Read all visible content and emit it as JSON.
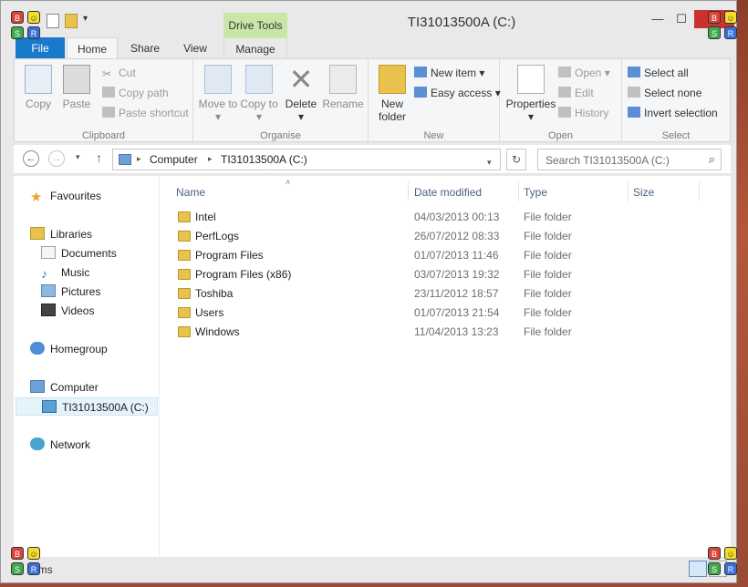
{
  "window": {
    "title": "TI31013500A (C:)",
    "context_tab": "Drive Tools",
    "minimize": "—",
    "maximize": "☐",
    "close": "✕"
  },
  "ribbon_tabs": {
    "file": "File",
    "home": "Home",
    "share": "Share",
    "view": "View",
    "manage": "Manage"
  },
  "ribbon": {
    "clipboard": {
      "label": "Clipboard",
      "copy": "Copy",
      "paste": "Paste",
      "cut": "Cut",
      "copy_path": "Copy path",
      "paste_shortcut": "Paste shortcut"
    },
    "organise": {
      "label": "Organise",
      "move_to": "Move to ▾",
      "copy_to": "Copy to ▾",
      "delete": "Delete ▾",
      "rename": "Rename"
    },
    "new": {
      "label": "New",
      "new_folder": "New folder",
      "new_item": "New item ▾",
      "easy_access": "Easy access ▾"
    },
    "open": {
      "label": "Open",
      "properties": "Properties ▾",
      "open": "Open ▾",
      "edit": "Edit",
      "history": "History"
    },
    "select": {
      "label": "Select",
      "select_all": "Select all",
      "select_none": "Select none",
      "invert_selection": "Invert selection"
    }
  },
  "address": {
    "crumbs": [
      "Computer",
      "TI31013500A (C:)"
    ],
    "search_placeholder": "Search TI31013500A (C:)"
  },
  "nav": {
    "favourites": "Favourites",
    "libraries": "Libraries",
    "documents": "Documents",
    "music": "Music",
    "pictures": "Pictures",
    "videos": "Videos",
    "homegroup": "Homegroup",
    "computer": "Computer",
    "drive": "TI31013500A (C:)",
    "network": "Network"
  },
  "columns": {
    "name": "Name",
    "date_modified": "Date modified",
    "type": "Type",
    "size": "Size"
  },
  "files": [
    {
      "name": "Intel",
      "date": "04/03/2013 00:13",
      "type": "File folder"
    },
    {
      "name": "PerfLogs",
      "date": "26/07/2012 08:33",
      "type": "File folder"
    },
    {
      "name": "Program Files",
      "date": "01/07/2013 11:46",
      "type": "File folder"
    },
    {
      "name": "Program Files (x86)",
      "date": "03/07/2013 19:32",
      "type": "File folder"
    },
    {
      "name": "Toshiba",
      "date": "23/11/2012 18:57",
      "type": "File folder"
    },
    {
      "name": "Users",
      "date": "01/07/2013 21:54",
      "type": "File folder"
    },
    {
      "name": "Windows",
      "date": "11/04/2013 13:23",
      "type": "File folder"
    }
  ],
  "status": {
    "text": "ems"
  },
  "overlay_buttons": [
    "B",
    "S",
    "R"
  ]
}
